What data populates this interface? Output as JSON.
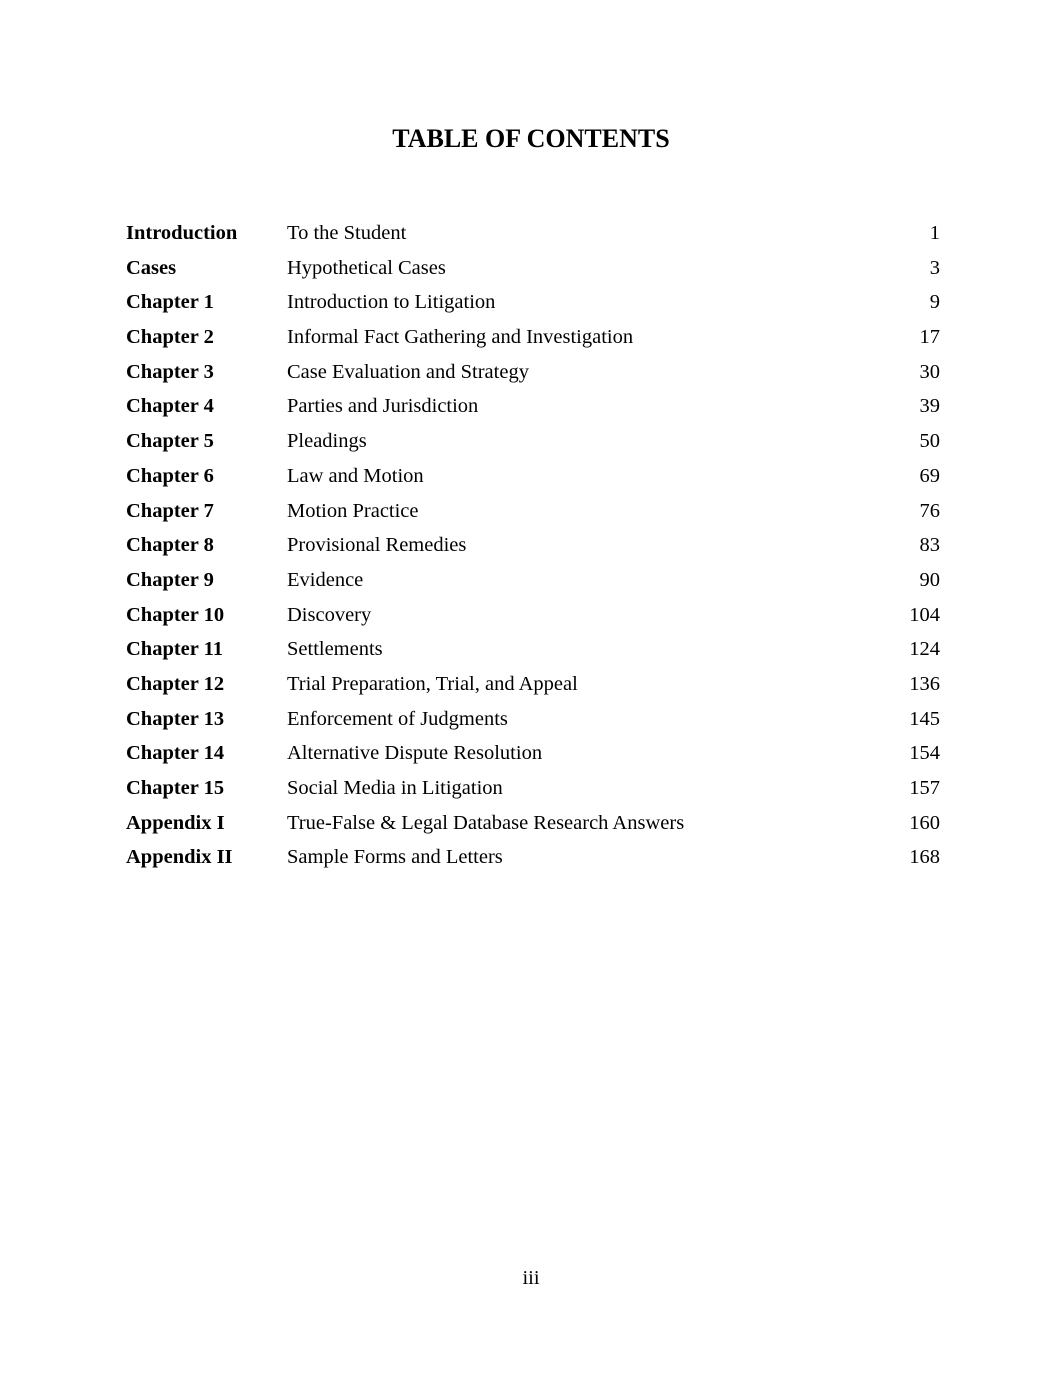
{
  "title": "TABLE OF CONTENTS",
  "entries": [
    {
      "label": "Introduction",
      "title": "To the Student",
      "page": "1"
    },
    {
      "label": "Cases",
      "title": "Hypothetical Cases",
      "page": "3"
    },
    {
      "label": "Chapter 1",
      "title": "Introduction to Litigation",
      "page": "9"
    },
    {
      "label": "Chapter 2",
      "title": "Informal Fact Gathering and Investigation",
      "page": "17"
    },
    {
      "label": "Chapter 3",
      "title": "Case Evaluation and Strategy",
      "page": "30"
    },
    {
      "label": "Chapter 4",
      "title": "Parties and Jurisdiction",
      "page": "39"
    },
    {
      "label": "Chapter 5",
      "title": "Pleadings",
      "page": "50"
    },
    {
      "label": "Chapter 6",
      "title": "Law and Motion",
      "page": "69"
    },
    {
      "label": "Chapter 7",
      "title": "Motion Practice",
      "page": "76"
    },
    {
      "label": "Chapter 8",
      "title": "Provisional Remedies",
      "page": "83"
    },
    {
      "label": "Chapter 9",
      "title": "Evidence",
      "page": "90"
    },
    {
      "label": "Chapter 10",
      "title": "Discovery",
      "page": "104"
    },
    {
      "label": "Chapter 11",
      "title": "Settlements",
      "page": "124"
    },
    {
      "label": "Chapter 12",
      "title": "Trial Preparation, Trial, and Appeal",
      "page": "136"
    },
    {
      "label": "Chapter 13",
      "title": "Enforcement of Judgments",
      "page": "145"
    },
    {
      "label": "Chapter 14",
      "title": "Alternative Dispute Resolution",
      "page": "154"
    },
    {
      "label": "Chapter 15",
      "title": "Social Media in Litigation",
      "page": "157"
    },
    {
      "label": "Appendix I",
      "title": "True-False & Legal Database Research Answers",
      "page": "160"
    },
    {
      "label": "Appendix II",
      "title": "Sample Forms and Letters",
      "page": "168"
    }
  ],
  "page_number": "iii"
}
